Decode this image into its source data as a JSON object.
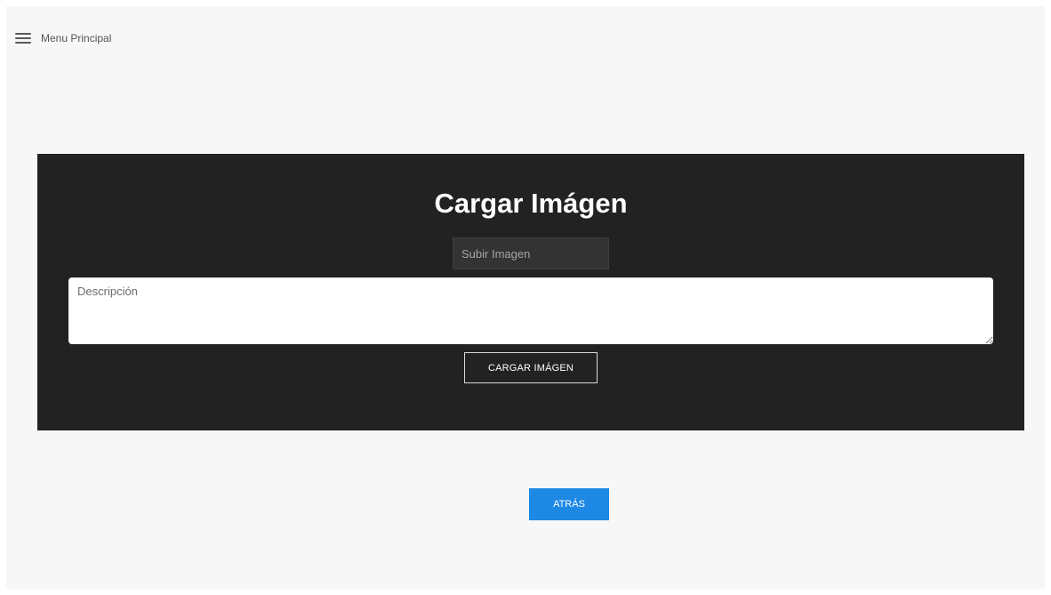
{
  "header": {
    "menu_label": "Menu Principal",
    "menu_icon": "hamburger-icon"
  },
  "form": {
    "title": "Cargar Imágen",
    "file_placeholder": "Subir Imagen",
    "description_placeholder": "Descripción",
    "description_value": "",
    "submit_label": "CARGAR IMÁGEN"
  },
  "navigation": {
    "back_label": "ATRÁS"
  },
  "colors": {
    "page_background": "#f7f7f7",
    "card_background": "#222222",
    "accent": "#1e88e5"
  }
}
